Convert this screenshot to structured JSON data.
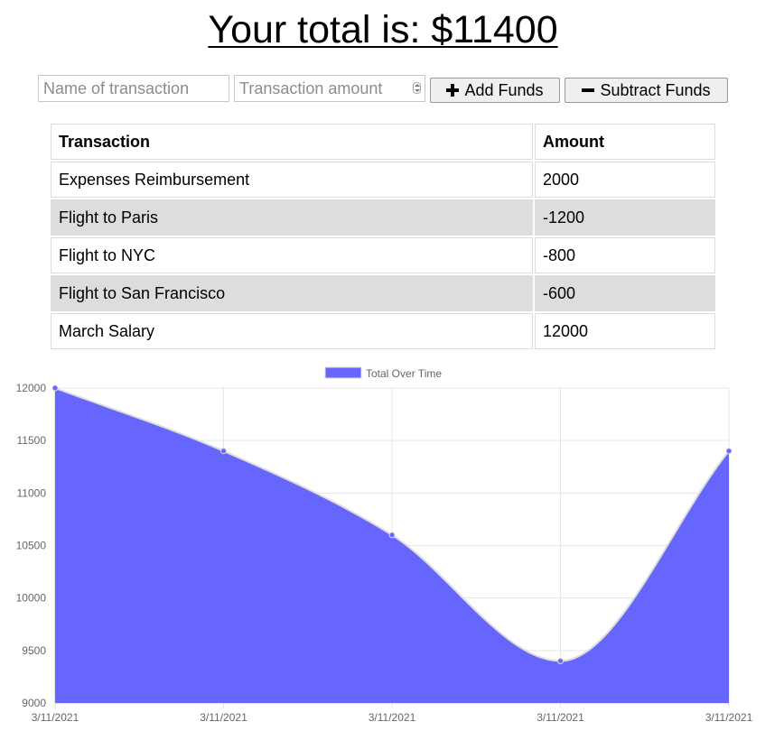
{
  "header": {
    "title": "Your total is: $11400"
  },
  "form": {
    "name_placeholder": "Name of transaction",
    "amount_placeholder": "Transaction amount",
    "add_label": "Add Funds",
    "subtract_label": "Subtract Funds"
  },
  "table": {
    "headers": [
      "Transaction",
      "Amount"
    ],
    "rows": [
      [
        "Expenses Reimbursement",
        "2000"
      ],
      [
        "Flight to Paris",
        "-1200"
      ],
      [
        "Flight to NYC",
        "-800"
      ],
      [
        "Flight to San Francisco",
        "-600"
      ],
      [
        "March Salary",
        "12000"
      ]
    ]
  },
  "colors": {
    "series_fill": "#6666ff",
    "grid": "#e6e6e6",
    "axis_text": "#666666"
  },
  "chart_data": {
    "type": "area",
    "x": [
      "3/11/2021",
      "3/11/2021",
      "3/11/2021",
      "3/11/2021",
      "3/11/2021"
    ],
    "series": [
      {
        "name": "Total Over Time",
        "values": [
          12000,
          11400,
          10600,
          9400,
          11400
        ]
      }
    ],
    "ylim": [
      9000,
      12000
    ],
    "yticks": [
      12000,
      11500,
      11000,
      10500,
      10000,
      9500,
      9000
    ],
    "grid": true,
    "legend": "top-center",
    "title": "",
    "xlabel": "",
    "ylabel": ""
  }
}
